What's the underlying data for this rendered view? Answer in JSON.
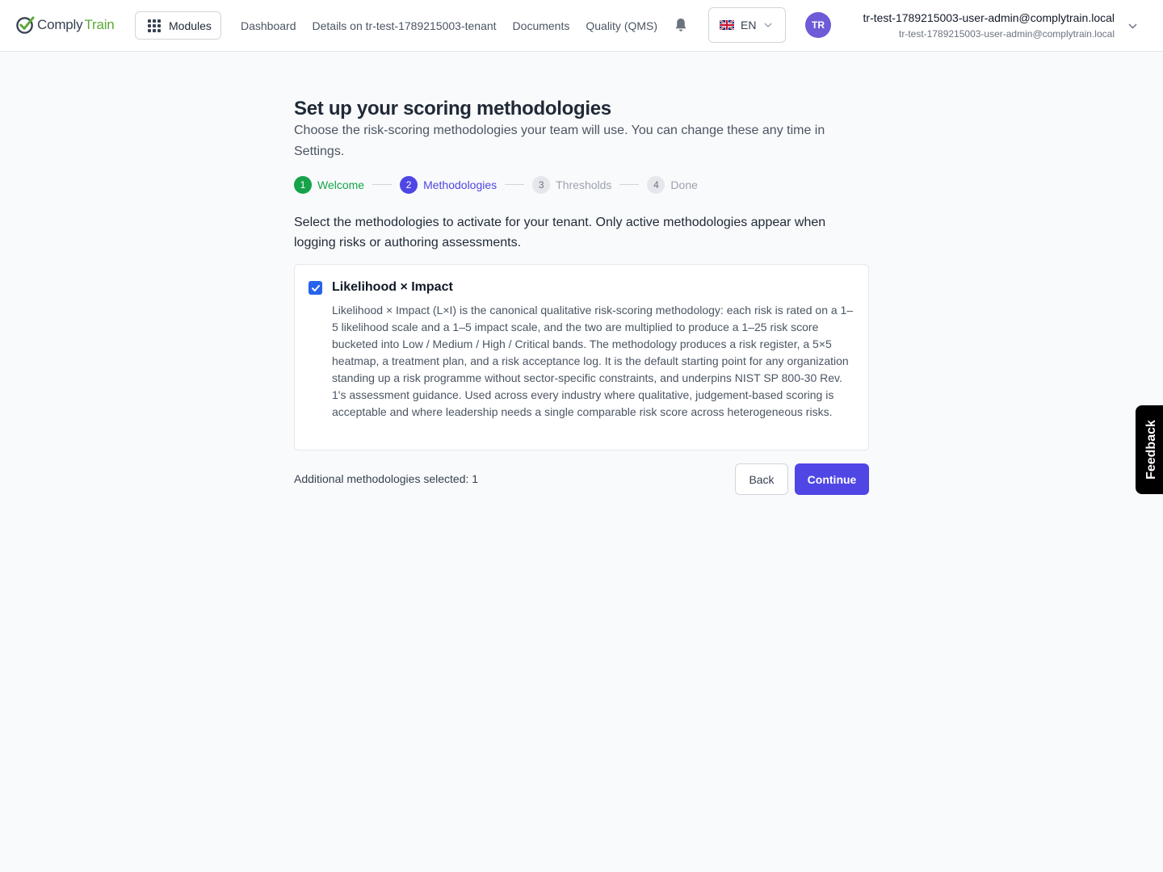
{
  "brand": {
    "name_part1": "Comply",
    "name_part2": "Train",
    "check_color": "#5aa935"
  },
  "header": {
    "modules_label": "Modules",
    "nav": [
      "Dashboard",
      "Details on tr-test-1789215003-tenant",
      "Documents",
      "Quality (QMS)"
    ],
    "language": "EN",
    "user": {
      "initials": "TR",
      "name": "tr-test-1789215003-user-admin@complytrain.local",
      "email": "tr-test-1789215003-user-admin@complytrain.local"
    }
  },
  "page": {
    "title": "Set up your scoring methodologies",
    "subtitle": "Choose the risk-scoring methodologies your team will use. You can change these any time in Settings.",
    "steps": [
      {
        "num": "1",
        "label": "Welcome",
        "state": "done"
      },
      {
        "num": "2",
        "label": "Methodologies",
        "state": "active"
      },
      {
        "num": "3",
        "label": "Thresholds",
        "state": "todo"
      },
      {
        "num": "4",
        "label": "Done",
        "state": "todo"
      }
    ],
    "intro": "Select the methodologies to activate for your tenant. Only active methodologies appear when logging risks or authoring assessments.",
    "methodology": {
      "title": "Likelihood × Impact",
      "checked": true,
      "description": "Likelihood × Impact (L×I) is the canonical qualitative risk-scoring methodology: each risk is rated on a 1–5 likelihood scale and a 1–5 impact scale, and the two are multiplied to produce a 1–25 risk score bucketed into Low / Medium / High / Critical bands. The methodology produces a risk register, a 5×5 heatmap, a treatment plan, and a risk acceptance log. It is the default starting point for any organization standing up a risk programme without sector-specific constraints, and underpins NIST SP 800-30 Rev. 1's assessment guidance. Used across every industry where qualitative, judgement-based scoring is acceptable and where leadership needs a single comparable risk score across heterogeneous risks."
    },
    "selected_count": "Additional methodologies selected: 1",
    "back_label": "Back",
    "continue_label": "Continue"
  },
  "feedback_label": "Feedback",
  "colors": {
    "primary": "#4f46e5",
    "success": "#16a34a",
    "checkbox": "#2563eb"
  }
}
